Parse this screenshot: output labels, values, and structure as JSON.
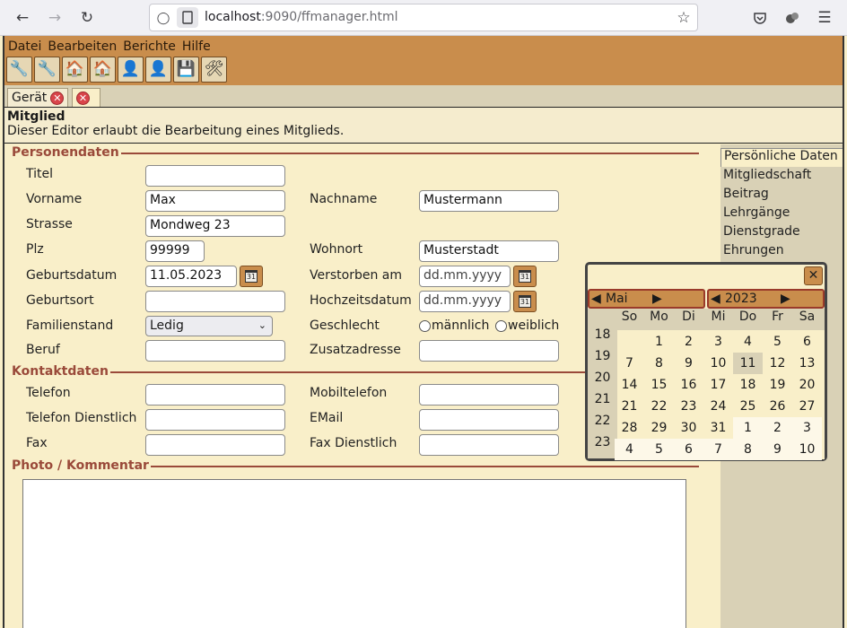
{
  "browser": {
    "url_host": "localhost",
    "url_rest": ":9090/ffmanager.html"
  },
  "menu": [
    "Datei",
    "Bearbeiten",
    "Berichte",
    "Hilfe"
  ],
  "toolbar_icons": [
    "tools-help-icon",
    "tools-icon",
    "house-help-icon",
    "house-icon",
    "person-help-icon",
    "person-icon",
    "save-icon",
    "settings-tools-icon"
  ],
  "tabs": [
    {
      "label": "Gerät"
    },
    {
      "label": ""
    }
  ],
  "editor": {
    "title": "Mitglied",
    "description": "Dieser Editor erlaubt die Bearbeitung eines Mitglieds."
  },
  "sections": {
    "personal": "Personendaten",
    "contact": "Kontaktdaten",
    "photo": "Photo / Kommentar"
  },
  "labels": {
    "title": "Titel",
    "firstname": "Vorname",
    "lastname": "Nachname",
    "street": "Strasse",
    "zip": "Plz",
    "city": "Wohnort",
    "birthdate": "Geburtsdatum",
    "deathdate": "Verstorben am",
    "birthplace": "Geburtsort",
    "weddingdate": "Hochzeitsdatum",
    "marital": "Familienstand",
    "gender": "Geschlecht",
    "job": "Beruf",
    "address2": "Zusatzadresse",
    "phone": "Telefon",
    "mobile": "Mobiltelefon",
    "phone_work": "Telefon Dienstlich",
    "email": "EMail",
    "fax": "Fax",
    "fax_work": "Fax Dienstlich"
  },
  "values": {
    "title": "",
    "firstname": "Max",
    "lastname": "Mustermann",
    "street": "Mondweg 23",
    "zip": "99999",
    "city": "Musterstadt",
    "birthdate": "11.05.2023",
    "deathdate": "",
    "birthplace": "",
    "weddingdate": "",
    "marital": "Ledig",
    "job": "",
    "address2": "",
    "phone": "",
    "mobile": "",
    "phone_work": "",
    "email": "",
    "fax": "",
    "fax_work": ""
  },
  "placeholders": {
    "date": "dd.mm.yyyy"
  },
  "gender_options": [
    "männlich",
    "weiblich"
  ],
  "side_nav": [
    "Persönliche Daten",
    "Mitgliedschaft",
    "Beitrag",
    "Lehrgänge",
    "Dienstgrade",
    "Ehrungen"
  ],
  "calendar": {
    "close": "✕",
    "month": "Mai",
    "year": "2023",
    "prev": "◀",
    "next": "▶",
    "weekdays": [
      "So",
      "Mo",
      "Di",
      "Mi",
      "Do",
      "Fr",
      "Sa"
    ],
    "weeks": [
      "18",
      "19",
      "20",
      "21",
      "22",
      "23"
    ],
    "days": [
      [
        "",
        "1",
        "2",
        "3",
        "4",
        "5",
        "6"
      ],
      [
        "7",
        "8",
        "9",
        "10",
        "11",
        "12",
        "13"
      ],
      [
        "14",
        "15",
        "16",
        "17",
        "18",
        "19",
        "20"
      ],
      [
        "21",
        "22",
        "23",
        "24",
        "25",
        "26",
        "27"
      ],
      [
        "28",
        "29",
        "30",
        "31",
        "1",
        "2",
        "3"
      ],
      [
        "4",
        "5",
        "6",
        "7",
        "8",
        "9",
        "10"
      ]
    ],
    "selected_day": "11"
  }
}
